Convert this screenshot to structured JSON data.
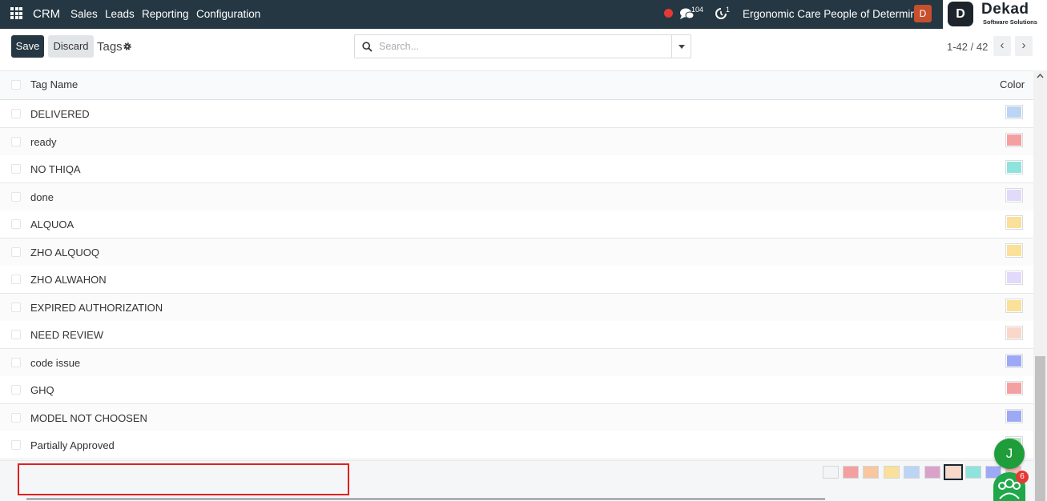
{
  "navbar": {
    "app_name": "CRM",
    "menu": [
      "Sales",
      "Leads",
      "Reporting",
      "Configuration"
    ],
    "chat_count": "104",
    "activity_count": "1",
    "company": "Ergonomic Care People of Determina...",
    "user_initial": "D",
    "logo": {
      "mark": "D",
      "name": "Dekad",
      "tagline": "Software Solutions"
    }
  },
  "control_panel": {
    "save_label": "Save",
    "discard_label": "Discard",
    "title": "Tags",
    "search_placeholder": "Search...",
    "search_value": "",
    "pager_value": "1-42 / 42"
  },
  "list": {
    "columns": {
      "name": "Tag Name",
      "color": "Color"
    },
    "rows": [
      {
        "name": "DELIVERED",
        "color": "#bcd5f5"
      },
      {
        "name": "ready",
        "color": "#f4a0a0"
      },
      {
        "name": "NO THIQA",
        "color": "#8fe3dd"
      },
      {
        "name": "done",
        "color": "#e2dafa"
      },
      {
        "name": "ALQUOA",
        "color": "#fbe09a"
      },
      {
        "name": "ZHO ALQUOQ",
        "color": "#fbe09a"
      },
      {
        "name": "ZHO ALWAHON",
        "color": "#e2dafa"
      },
      {
        "name": "EXPIRED AUTHORIZATION",
        "color": "#fbe09a"
      },
      {
        "name": "NEED REVIEW",
        "color": "#f9d7c9"
      },
      {
        "name": "code issue",
        "color": "#9ea9f5"
      },
      {
        "name": "GHQ",
        "color": "#f4a0a0"
      },
      {
        "name": "MODEL NOT CHOOSEN",
        "color": "#9ea9f5"
      },
      {
        "name": "Partially Approved",
        "color": "#bfe8c4"
      }
    ]
  },
  "editor": {
    "new_tag_value": "",
    "palette": [
      "#f3f4f5",
      "#f4a0a0",
      "#f6c7a0",
      "#fbe09a",
      "#bcd5f5",
      "#d9a3c9",
      "#f9d7c9",
      "#8fe3dd",
      "#9ea9f5",
      "#f4b7b7"
    ],
    "selected_index": 6
  },
  "floating": {
    "assistant_initial": "J",
    "team_badge": "6"
  },
  "colors": {
    "navbar": "#243742",
    "primary": "#243742",
    "highlight_border": "#e02020",
    "fab": "#1f9d3a"
  }
}
